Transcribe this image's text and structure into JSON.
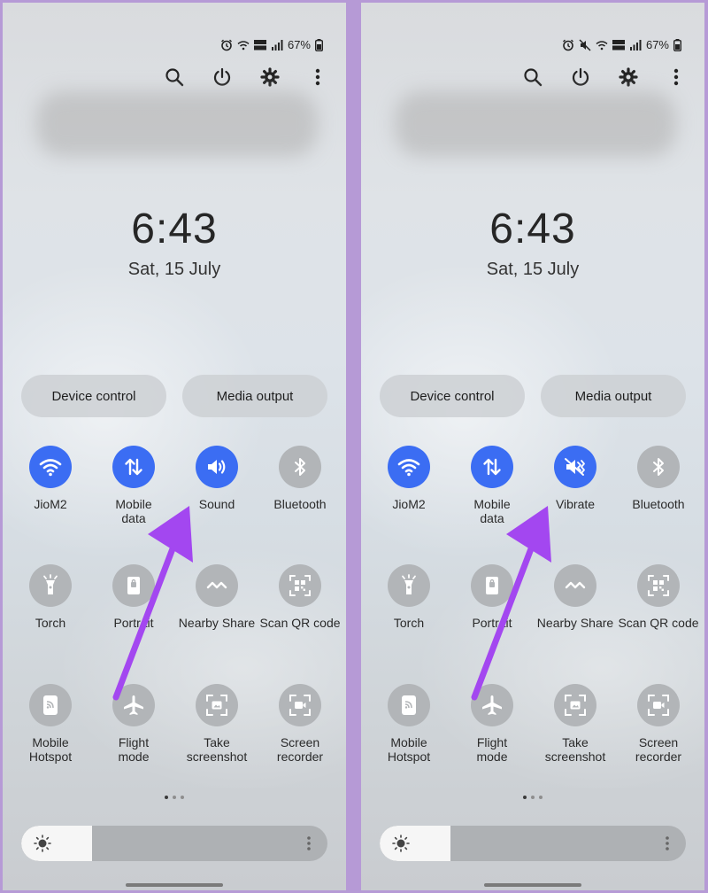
{
  "panels": [
    {
      "status": {
        "battery": "67%"
      },
      "clock": {
        "time": "6:43",
        "date": "Sat, 15 July"
      },
      "buttons": {
        "device_control": "Device control",
        "media_output": "Media output"
      },
      "tiles": [
        {
          "label": "JioM2",
          "active": true,
          "icon": "wifi-icon"
        },
        {
          "label": "Mobile\ndata",
          "active": true,
          "icon": "mobile-data-icon"
        },
        {
          "label": "Sound",
          "active": true,
          "icon": "sound-icon"
        },
        {
          "label": "Bluetooth",
          "active": false,
          "icon": "bluetooth-icon"
        },
        {
          "label": "Torch",
          "active": false,
          "icon": "torch-icon"
        },
        {
          "label": "Portrait",
          "active": false,
          "icon": "portrait-icon"
        },
        {
          "label": "Nearby Share",
          "active": false,
          "icon": "nearby-share-icon"
        },
        {
          "label": "Scan QR code",
          "active": false,
          "icon": "qr-code-icon"
        },
        {
          "label": "Mobile\nHotspot",
          "active": false,
          "icon": "hotspot-icon"
        },
        {
          "label": "Flight\nmode",
          "active": false,
          "icon": "airplane-icon"
        },
        {
          "label": "Take\nscreenshot",
          "active": false,
          "icon": "screenshot-icon"
        },
        {
          "label": "Screen\nrecorder",
          "active": false,
          "icon": "screen-recorder-icon"
        }
      ],
      "brightness_level": 0.23
    },
    {
      "status": {
        "battery": "67%"
      },
      "clock": {
        "time": "6:43",
        "date": "Sat, 15 July"
      },
      "buttons": {
        "device_control": "Device control",
        "media_output": "Media output"
      },
      "tiles": [
        {
          "label": "JioM2",
          "active": true,
          "icon": "wifi-icon"
        },
        {
          "label": "Mobile\ndata",
          "active": true,
          "icon": "mobile-data-icon"
        },
        {
          "label": "Vibrate",
          "active": true,
          "icon": "vibrate-icon"
        },
        {
          "label": "Bluetooth",
          "active": false,
          "icon": "bluetooth-icon"
        },
        {
          "label": "Torch",
          "active": false,
          "icon": "torch-icon"
        },
        {
          "label": "Portrait",
          "active": false,
          "icon": "portrait-icon"
        },
        {
          "label": "Nearby Share",
          "active": false,
          "icon": "nearby-share-icon"
        },
        {
          "label": "Scan QR code",
          "active": false,
          "icon": "qr-code-icon"
        },
        {
          "label": "Mobile\nHotspot",
          "active": false,
          "icon": "hotspot-icon"
        },
        {
          "label": "Flight\nmode",
          "active": false,
          "icon": "airplane-icon"
        },
        {
          "label": "Take\nscreenshot",
          "active": false,
          "icon": "screenshot-icon"
        },
        {
          "label": "Screen\nrecorder",
          "active": false,
          "icon": "screen-recorder-icon"
        }
      ],
      "brightness_level": 0.23
    }
  ],
  "colors": {
    "tile_active": "#3b6df3",
    "tile_inactive": "#b2b5b8",
    "annotation_arrow": "#a347f0"
  }
}
